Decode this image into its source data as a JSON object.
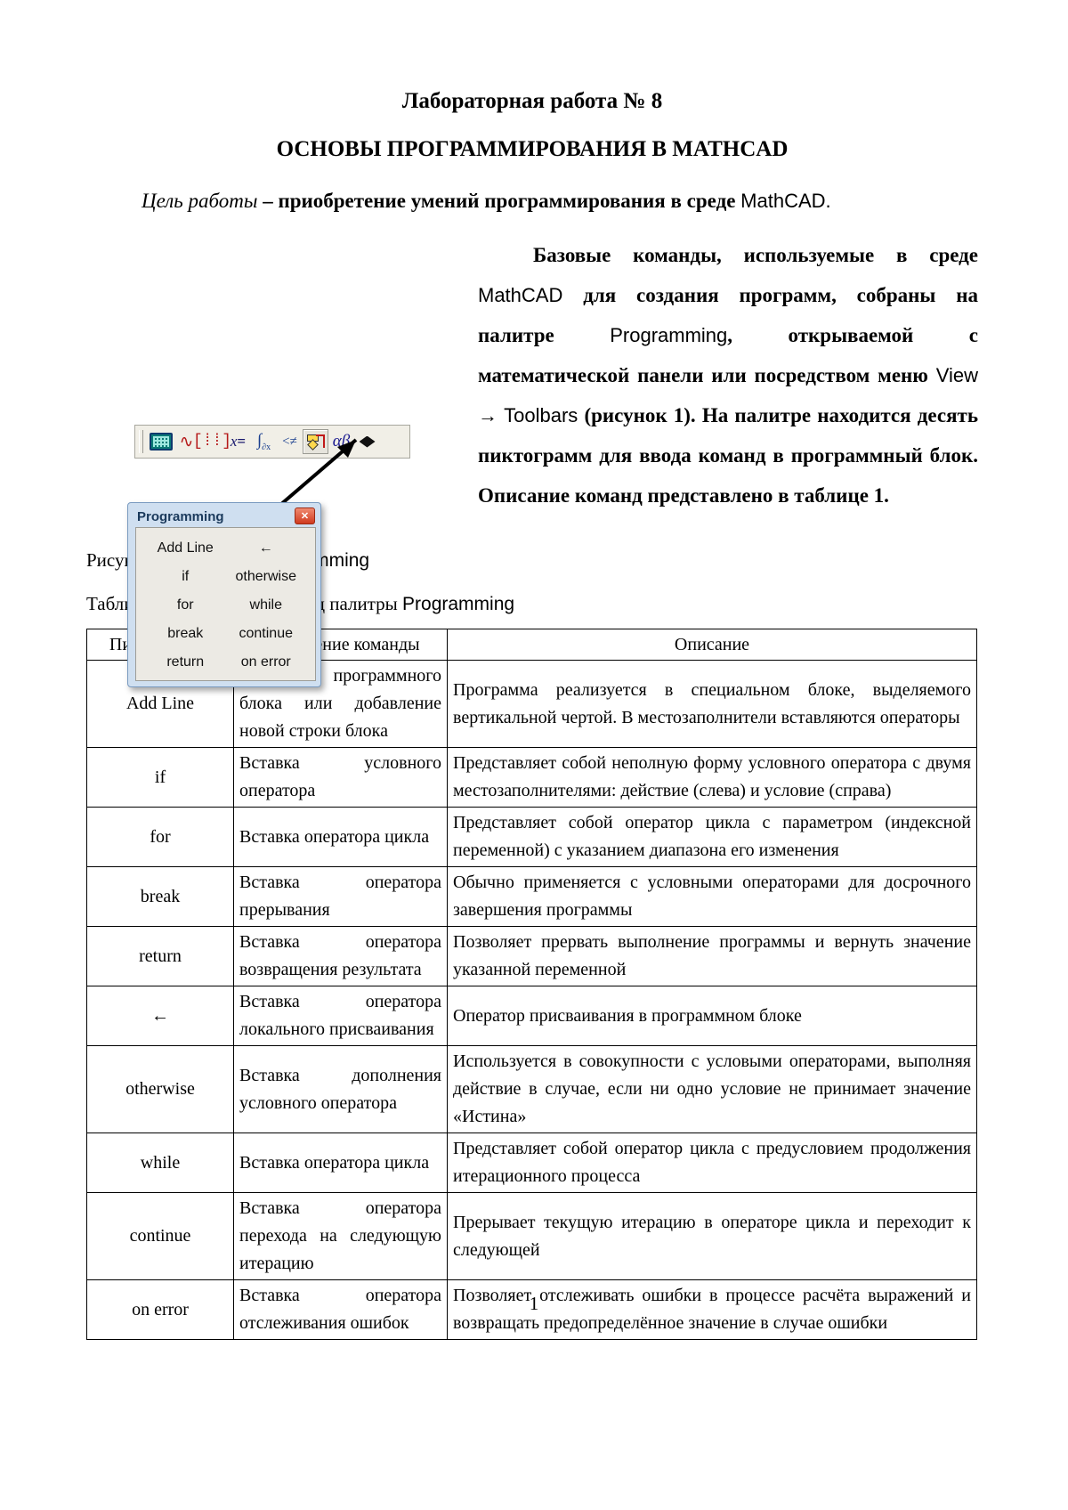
{
  "document": {
    "title_line": "Лабораторная работа № 8",
    "subtitle": "ОСНОВЫ ПРОГРАММИРОВАНИЯ В MATHCAD",
    "goal_label": "Цель работы",
    "goal_text_1": " – приобретение умений программирования в среде ",
    "goal_text_2": "MathCAD.",
    "page_number": "1"
  },
  "intro": {
    "p1": "Базовые команды, используемые в среде ",
    "mathcad": "MathCAD",
    "p2": " для создания программ, собраны на палитре ",
    "programming": "Programming",
    "p3": ", открываемой с математической панели или посредством меню ",
    "view": "View",
    "arrow": " → ",
    "toolbars": "Toolbars",
    "p4": " (рисунок 1). На палитре находится десять пиктограмм для ввода команд в программный блок. Описание команд представлено в таблице 1."
  },
  "toolbar": {
    "name": "Math toolbar",
    "buttons": [
      {
        "name": "calculator-icon",
        "label": "Calculator"
      },
      {
        "name": "graph-icon",
        "label": "Graph"
      },
      {
        "name": "matrix-icon",
        "label": "Matrix"
      },
      {
        "name": "evaluation-icon",
        "label": "x="
      },
      {
        "name": "calculus-icon",
        "label": "Calculus"
      },
      {
        "name": "boolean-icon",
        "label": "Boolean"
      },
      {
        "name": "programming-icon",
        "label": "Programming"
      },
      {
        "name": "greek-icon",
        "label": "αβ"
      },
      {
        "name": "symbolic-icon",
        "label": "Symbolic"
      }
    ]
  },
  "palette": {
    "title": "Programming",
    "close_label": "✕",
    "commands": [
      "Add Line",
      "←",
      "if",
      "otherwise",
      "for",
      "while",
      "break",
      "continue",
      "return",
      "on error"
    ]
  },
  "captions": {
    "figure_prefix": "Рисунок 1 – Палитра ",
    "figure_latin": "Programming",
    "table_prefix": "Таблица 1 – Описание команд палитры ",
    "table_latin": "Programming"
  },
  "table": {
    "headers": [
      "Пиктограмма",
      "Назначение команды",
      "Описание"
    ],
    "rows": [
      {
        "icon": "Add Line",
        "purpose": "Создание программного блока или добавление новой строки блока",
        "description": "Программа реализуется в специальном блоке, выделяемого вертикальной чертой. В местозаполнители вставляются операторы"
      },
      {
        "icon": "if",
        "purpose": "Вставка условного оператора",
        "description": "Представляет собой неполную форму условного оператора с двумя местозаполнителями: действие (слева) и условие (справа)"
      },
      {
        "icon": "for",
        "purpose": "Вставка оператора цикла",
        "description": "Представляет собой оператор цикла с параметром (индексной переменной) с указанием диапазона его изменения"
      },
      {
        "icon": "break",
        "purpose": "Вставка оператора прерывания",
        "description": "Обычно применяется с условными операторами для досрочного завершения программы"
      },
      {
        "icon": "return",
        "purpose": "Вставка оператора возвращения результата",
        "description": "Позволяет прервать выполнение программы и вернуть значение указанной переменной"
      },
      {
        "icon": "←",
        "purpose": "Вставка оператора локального присваивания",
        "description": "Оператор присваивания в программном блоке"
      },
      {
        "icon": "otherwise",
        "purpose": "Вставка дополнения условного оператора",
        "description": "Используется в совокупности с условыми операторами, выполняя действие в случае, если ни одно условие не принимает значение «Истина»"
      },
      {
        "icon": "while",
        "purpose": "Вставка оператора цикла",
        "description": "Представляет собой оператор цикла с предусловием продолжения итерационного процесса"
      },
      {
        "icon": "continue",
        "purpose": "Вставка оператора перехода на следующую итерацию",
        "description": "Прерывает текущую итерацию в операторе цикла и переходит к следующей"
      },
      {
        "icon": "on error",
        "purpose": "Вставка оператора отслеживания ошибок",
        "description": "Позволяет отслеживать ошибки в процессе расчёта выражений и возвращать предопределённое значение в случае ошибки"
      }
    ]
  }
}
